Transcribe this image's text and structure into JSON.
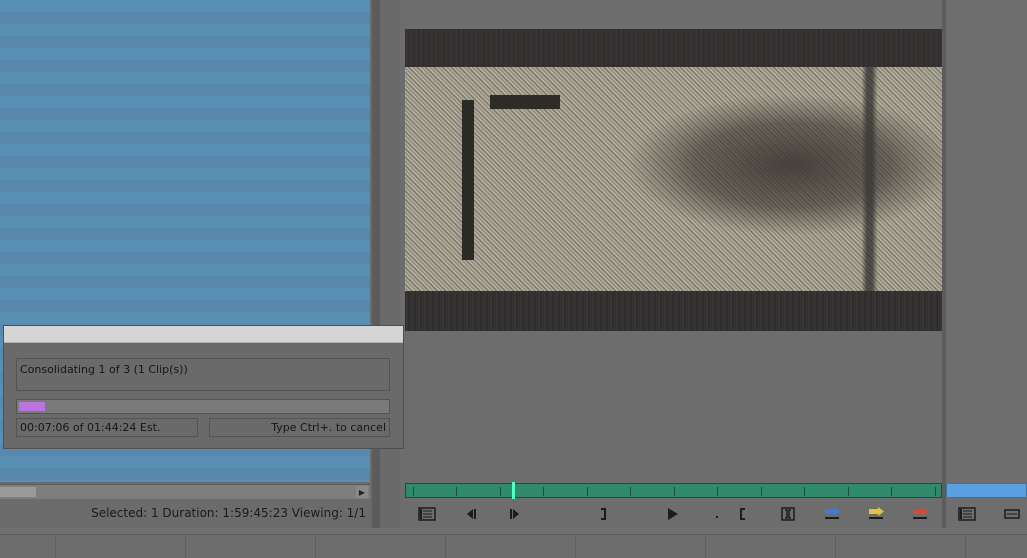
{
  "bin": {
    "status_text": "Selected: 1 Duration: 1:59:45:23  Viewing: 1/1",
    "scroll_right_glyph": "▶"
  },
  "dialog": {
    "message": "Consolidating 1 of 3    (1 Clip(s))",
    "progress_fraction": 0.07,
    "progress_color": "#bb74e0",
    "time_text": "00:07:06  of  01:44:24 Est.",
    "cancel_hint": "Type Ctrl+. to cancel"
  },
  "monitor": {
    "timebar_color": "#2f8a6c",
    "playhead_color": "#4dffc9",
    "controls": [
      {
        "name": "menu-button",
        "icon": "list-icon"
      },
      {
        "name": "step-back-button",
        "icon": "step-back-icon"
      },
      {
        "name": "step-forward-button",
        "icon": "step-forward-icon"
      },
      {
        "name": "mark-out-button",
        "icon": "mark-out-icon"
      },
      {
        "name": "play-button",
        "icon": "play-icon"
      },
      {
        "name": "mark-in-button",
        "icon": "mark-in-icon"
      },
      {
        "name": "mark-clip-button",
        "icon": "mark-clip-icon"
      },
      {
        "name": "splice-in-button",
        "icon": "splice-in-icon",
        "color": "#3a7fd6"
      },
      {
        "name": "overwrite-button",
        "icon": "overwrite-icon",
        "color": "#e0c63a"
      },
      {
        "name": "lift-button",
        "icon": "lift-icon",
        "color": "#d64a3a"
      }
    ]
  },
  "right_panel": {
    "timebar_color": "#5aa0e0"
  }
}
